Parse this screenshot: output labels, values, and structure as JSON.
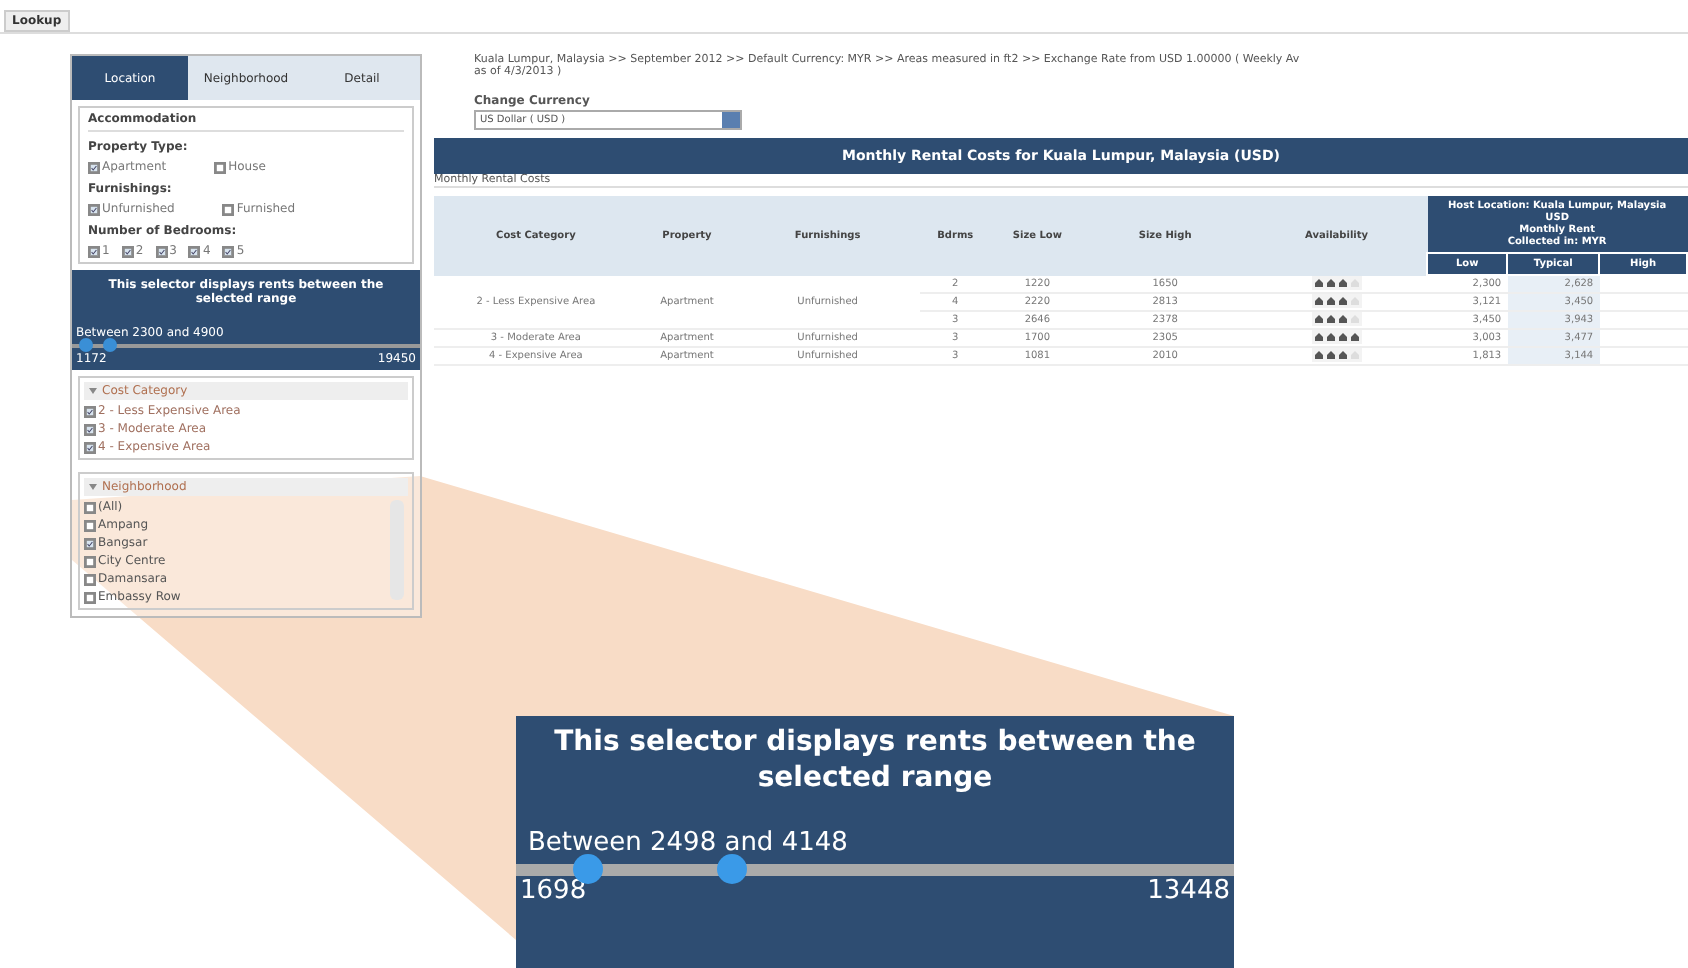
{
  "top_tab": {
    "label": "Lookup"
  },
  "filter_tabs": [
    {
      "label": "Location",
      "selected": true
    },
    {
      "label": "Neighborhood",
      "selected": false
    },
    {
      "label": "Detail",
      "selected": false
    }
  ],
  "accommodation": {
    "title": "Accommodation",
    "groups": [
      {
        "label": "Property Type:",
        "options": [
          {
            "label": "Apartment",
            "checked": true
          },
          {
            "label": "House",
            "checked": false
          }
        ]
      },
      {
        "label": "Furnishings:",
        "options": [
          {
            "label": "Unfurnished",
            "checked": true
          },
          {
            "label": "Furnished",
            "checked": false
          }
        ]
      },
      {
        "label": "Number of Bedrooms:",
        "options": [
          {
            "label": "1",
            "checked": true
          },
          {
            "label": "2",
            "checked": true
          },
          {
            "label": "3",
            "checked": true
          },
          {
            "label": "4",
            "checked": true
          },
          {
            "label": "5",
            "checked": true
          }
        ]
      }
    ]
  },
  "range_selector": {
    "description": "This selector displays rents between the selected range",
    "reading": "Between 2300 and 4900",
    "min": "1172",
    "max": "19450",
    "handles": [
      {
        "level": 0.04
      },
      {
        "level": 0.11
      }
    ]
  },
  "cost_category": {
    "title": "Cost Category",
    "options": [
      {
        "label": "2 - Less Expensive Area",
        "checked": true
      },
      {
        "label": "3 - Moderate Area",
        "checked": true
      },
      {
        "label": "4 - Expensive Area",
        "checked": true
      }
    ]
  },
  "neighborhood": {
    "title": "Neighborhood",
    "options": [
      {
        "label": "(All)",
        "checked": false
      },
      {
        "label": "Ampang",
        "checked": false
      },
      {
        "label": "Bangsar",
        "checked": true
      },
      {
        "label": "City Centre",
        "checked": false
      },
      {
        "label": "Damansara",
        "checked": false
      },
      {
        "label": "Embassy Row",
        "checked": false
      }
    ]
  },
  "info": {
    "line": "Kuala Lumpur, Malaysia >> September 2012 >> Default Currency: MYR >> Areas measured in ft2 >> Exchange Rate from USD 1.00000 ( Weekly Av",
    "line_2": "as of 4/3/2013 )"
  },
  "currency": {
    "label": "Change Currency",
    "value": "US Dollar ( USD )"
  },
  "banner": "Monthly Rental Costs for Kuala Lumpur, Malaysia (USD)",
  "section_label": "Monthly Rental Costs",
  "table": {
    "columns": [
      "Cost Category",
      "Property",
      "Furnishings",
      "Bdrms",
      "Size Low",
      "Size High",
      "Availability"
    ],
    "host_header": "Host Location: Kuala Lumpur, Malaysia",
    "rent_header": [
      "USD",
      "Monthly Rent",
      "Collected in: MYR"
    ],
    "rent_columns": [
      "Low",
      "Typical",
      "High"
    ],
    "rows": [
      {
        "category": "2 - Less Expensive Area",
        "property": "Apartment",
        "furnishings": "Unfurnished",
        "lines": [
          {
            "bdrms": "2",
            "size_low": "1220",
            "size_high": "1650",
            "stars": 3,
            "low": "2,300",
            "typical": "2,628"
          },
          {
            "bdrms": "4",
            "size_low": "2220",
            "size_high": "2813",
            "stars": 3,
            "low": "3,121",
            "typical": "3,450"
          },
          {
            "bdrms": "3",
            "size_low": "2646",
            "size_high": "2378",
            "stars": 3,
            "low": "3,450",
            "typical": "3,943"
          }
        ]
      },
      {
        "category": "3 - Moderate Area",
        "property": "Apartment",
        "furnishings": "Unfurnished",
        "lines": [
          {
            "bdrms": "3",
            "size_low": "1700",
            "size_high": "2305",
            "stars": 4,
            "low": "3,003",
            "typical": "3,477"
          }
        ]
      },
      {
        "category": "4 - Expensive Area",
        "property": "Apartment",
        "furnishings": "Unfurnished",
        "lines": [
          {
            "bdrms": "3",
            "size_low": "1081",
            "size_high": "2010",
            "stars": 3,
            "low": "1,813",
            "typical": "3,144"
          }
        ]
      }
    ]
  },
  "callout": {
    "description": "This selector displays rents between the selected range",
    "reading": "Between 2498 and 4148",
    "min": "1698",
    "max": "13448",
    "handles": [
      {
        "level": 0.1
      },
      {
        "level": 0.3
      }
    ]
  }
}
